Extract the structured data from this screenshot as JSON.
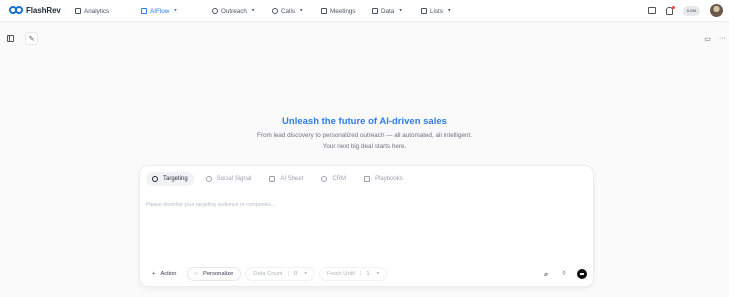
{
  "brand": {
    "name": "FlashRev"
  },
  "nav": {
    "analytics": "Analytics",
    "aiflow": "AIFlow",
    "outreach": "Outreach",
    "calls": "Calls",
    "meetings": "Meetings",
    "data": "Data",
    "lists": "Lists"
  },
  "user": {
    "initials": "ILXM"
  },
  "hero": {
    "title": "Unleash the future of AI-driven sales",
    "subtitle_line1": "From lead discovery to personalized outreach — all automated, all intelligent.",
    "subtitle_line2": "Your next big deal starts here."
  },
  "composer": {
    "tabs": [
      "Targeting",
      "Social Signal",
      "AI Sheet",
      "CRM",
      "Playbooks"
    ],
    "placeholder": "Please describe your targeting audience or companies...",
    "action_label": "Action",
    "personalize_label": "Personalize",
    "data_count_label": "Data Count",
    "data_count_value": "0",
    "fresh_until_label": "Fresh Until",
    "fresh_until_value": "1"
  },
  "colors": {
    "accent": "#2b7de9",
    "send": "#111111"
  }
}
